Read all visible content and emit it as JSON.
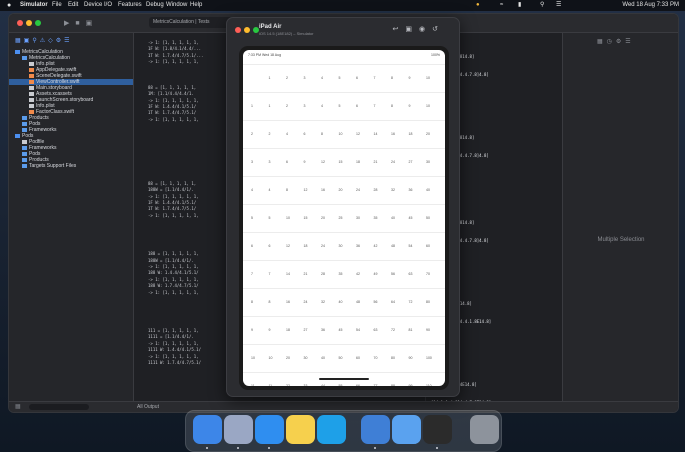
{
  "menubar": {
    "apple": "",
    "app": "Simulator",
    "items": [
      "File",
      "Edit",
      "Device",
      "I/O",
      "Features",
      "Debug",
      "Window",
      "Help"
    ],
    "clock": "Wed 18 Aug  7:33 PM"
  },
  "xcode": {
    "tab_label": "MetricsCalculation  |  Tests",
    "tree": [
      {
        "label": "MetricsCalculation",
        "kind": "project",
        "indent": 0,
        "selected": false
      },
      {
        "label": "MetricsCalculation",
        "kind": "folder",
        "indent": 1,
        "selected": false
      },
      {
        "label": "Info.plist",
        "kind": "file",
        "indent": 2,
        "selected": false
      },
      {
        "label": "AppDelegate.swift",
        "kind": "swift",
        "indent": 2,
        "selected": false
      },
      {
        "label": "SceneDelegate.swift",
        "kind": "swift",
        "indent": 2,
        "selected": false
      },
      {
        "label": "ViewController.swift",
        "kind": "swift",
        "indent": 2,
        "selected": true
      },
      {
        "label": "Main.storyboard",
        "kind": "file",
        "indent": 2,
        "selected": false
      },
      {
        "label": "Assets.xcassets",
        "kind": "file",
        "indent": 2,
        "selected": false
      },
      {
        "label": "LaunchScreen.storyboard",
        "kind": "file",
        "indent": 2,
        "selected": false
      },
      {
        "label": "Info.plist",
        "kind": "file",
        "indent": 2,
        "selected": false
      },
      {
        "label": "FactorClass.swift",
        "kind": "swift",
        "indent": 2,
        "selected": false
      },
      {
        "label": "Products",
        "kind": "folder",
        "indent": 1,
        "selected": false
      },
      {
        "label": "Pods",
        "kind": "folder",
        "indent": 1,
        "selected": false
      },
      {
        "label": "Frameworks",
        "kind": "folder",
        "indent": 1,
        "selected": false
      },
      {
        "label": "Pods",
        "kind": "project",
        "indent": 0,
        "selected": false
      },
      {
        "label": "Podfile",
        "kind": "file",
        "indent": 1,
        "selected": false
      },
      {
        "label": "Frameworks",
        "kind": "folder",
        "indent": 1,
        "selected": false
      },
      {
        "label": "Pods",
        "kind": "folder",
        "indent": 1,
        "selected": false
      },
      {
        "label": "Products",
        "kind": "folder",
        "indent": 1,
        "selected": false
      },
      {
        "label": "Targets Support Files",
        "kind": "folder",
        "indent": 1,
        "selected": false
      }
    ],
    "code": [
      "-> 1: [1, 1, 1, 1, 1,",
      "1F W: [1.8/4.1/4.4/...",
      "1T W: 1.7.4/4.7/5.1/...",
      "-> 1: [1, 1, 1, 1, 1,",
      "",
      "",
      "",
      "88 = [1, 1, 1, 1, 1,",
      "1M: [1.1/4.4/4.4/1.",
      "-> 1: [1, 1, 1, 1, 1,",
      "1F W: 1.4.4/4.1/5.1/",
      "1T W: 1.7.4/4.7/5.1/",
      "-> 1: [1, 1, 1, 1, 1,",
      "",
      "",
      "",
      "",
      "",
      "",
      "",
      "",
      "",
      "88 = [1, 1, 1, 1, 1,",
      "188W = [1.1/4.4/1/.",
      "-> 1: [1, 1, 1, 1, 1,",
      "1F W: 1.4.4/4.1/5.1/",
      "1T W: 1.7.4/4.7/5.1/",
      "-> 1: [1, 1, 1, 1, 1,",
      "",
      "",
      "",
      "",
      "",
      "188 = [1, 1, 1, 1, 1,",
      "188W = [1.1/4.4/1/.",
      "-> 1: [1, 1, 1, 1, 1,",
      "188 W: 1.4.4/4.1/5.1/",
      "-> 1: [1, 1, 1, 1, 1,",
      "188 W: 1.7.4/4.7/5.1/",
      "-> 1: [1, 1, 1, 1, 1,",
      "",
      "",
      "",
      "",
      "",
      "111 = [1, 1, 1, 1, 1,",
      "1111 = [1.1/4.4/1/.",
      "-> 1: [1, 1, 1, 1, 1,",
      "1111 W: 1.4.4/4.1/5.1/",
      "-> 1: [1, 1, 1, 1, 1,",
      "1111 W: 1.7.4/4.7/5.1/"
    ],
    "canvas_lines": [
      {
        "text": "[1.4814.4E.4814.8]",
        "row": 3
      },
      {
        "text": "[1f-1.1,4.814.4.7.8]4.8]",
        "row": 7
      },
      {
        "text": "[1.4814.4E.4814.8]",
        "row": 21
      },
      {
        "text": "[1f-1.1,4.814.4.7.8]4.8]",
        "row": 25
      },
      {
        "text": "[1.4814.4E.4814.8]",
        "row": 40
      },
      {
        "text": "[1f-1.1,4.814.4.7.8]4.8]",
        "row": 44
      },
      {
        "text": "[1.1,4E14.4E14.8]",
        "row": 58
      },
      {
        "text": "[4f-1.1,4.814.4.1.8E14.8]",
        "row": 62
      },
      {
        "text": "[1.1,4E14.4.4E14.8]",
        "row": 76
      },
      {
        "text": "[1f-1.1,4.814.4.7.8E14.8]",
        "row": 80
      }
    ],
    "inspector_empty": "Multiple Selection",
    "debug_label": "All Output"
  },
  "simulator": {
    "title": "iPad Air",
    "subtitle": "iOS 14.5 (18E182) – Simulator",
    "statusbar_left": "7:33 PM  Wed 18 Aug",
    "statusbar_right": "100%",
    "grid": {
      "header": [
        "",
        "1",
        "2",
        "3",
        "4",
        "5",
        "6",
        "7",
        "8",
        "9",
        "10"
      ],
      "rows": [
        [
          "1",
          "1",
          "2",
          "3",
          "4",
          "5",
          "6",
          "7",
          "8",
          "9",
          "10"
        ],
        [
          "2",
          "2",
          "4",
          "6",
          "8",
          "10",
          "12",
          "14",
          "16",
          "18",
          "20"
        ],
        [
          "3",
          "3",
          "6",
          "9",
          "12",
          "15",
          "18",
          "21",
          "24",
          "27",
          "30"
        ],
        [
          "4",
          "4",
          "8",
          "12",
          "16",
          "20",
          "24",
          "28",
          "32",
          "36",
          "40"
        ],
        [
          "5",
          "5",
          "10",
          "15",
          "20",
          "25",
          "30",
          "35",
          "40",
          "45",
          "50"
        ],
        [
          "6",
          "6",
          "12",
          "18",
          "24",
          "30",
          "36",
          "42",
          "48",
          "54",
          "60"
        ],
        [
          "7",
          "7",
          "14",
          "21",
          "28",
          "35",
          "42",
          "49",
          "56",
          "63",
          "70"
        ],
        [
          "8",
          "8",
          "16",
          "24",
          "32",
          "40",
          "48",
          "56",
          "64",
          "72",
          "80"
        ],
        [
          "9",
          "9",
          "18",
          "27",
          "36",
          "45",
          "54",
          "63",
          "72",
          "81",
          "90"
        ],
        [
          "10",
          "10",
          "20",
          "30",
          "40",
          "50",
          "60",
          "70",
          "80",
          "90",
          "100"
        ],
        [
          "11",
          "11",
          "22",
          "33",
          "44",
          "55",
          "66",
          "77",
          "88",
          "99",
          "110"
        ]
      ]
    }
  },
  "dock": {
    "apps": [
      {
        "name": "Finder",
        "color": "#3d86e8"
      },
      {
        "name": "Launchpad",
        "color": "#9aa7c4"
      },
      {
        "name": "Safari",
        "color": "#2f8ef0"
      },
      {
        "name": "Notes",
        "color": "#f6d04d"
      },
      {
        "name": "Skype",
        "color": "#1ea0e8"
      },
      {
        "name": "Xcode",
        "color": "#3f7fd6"
      },
      {
        "name": "Finder",
        "color": "#5aa2ef"
      },
      {
        "name": "Terminal",
        "color": "#2b2b2b"
      },
      {
        "name": "Trash",
        "color": "#8d939c"
      }
    ]
  }
}
